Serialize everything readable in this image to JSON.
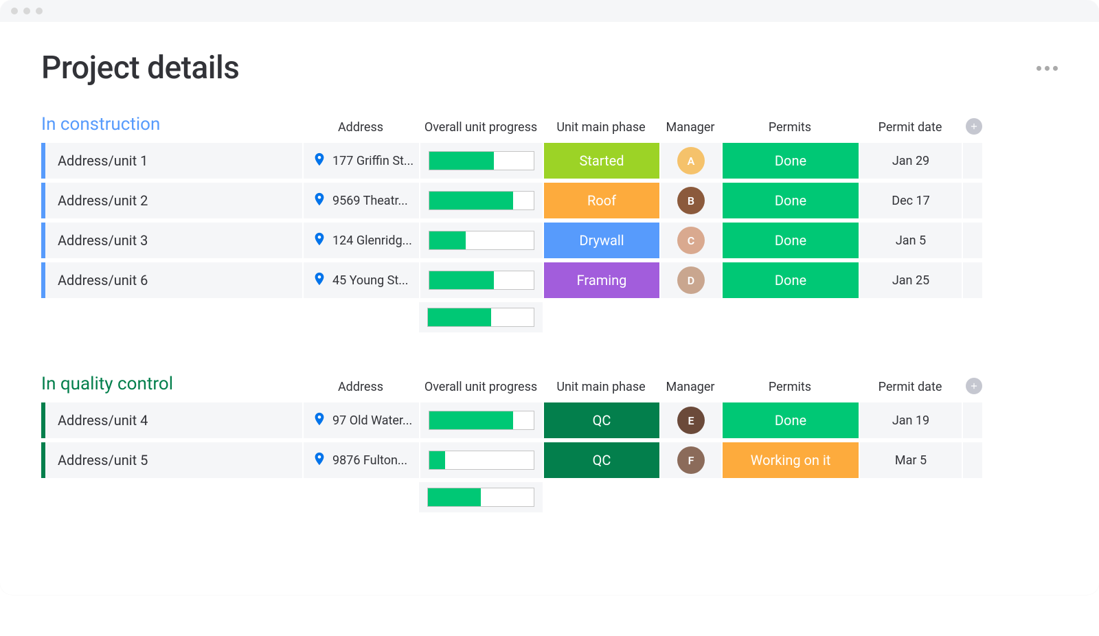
{
  "page_title": "Project details",
  "columns": {
    "address": "Address",
    "progress": "Overall unit progress",
    "phase": "Unit main phase",
    "manager": "Manager",
    "permits": "Permits",
    "permit_date": "Permit date"
  },
  "phase_colors": {
    "Started": "#9cd326",
    "Roof": "#fdab3d",
    "Drywall": "#579bfc",
    "Framing": "#a25ddc",
    "QC": "#037f4c"
  },
  "permit_colors": {
    "Done": "#00c875",
    "Working on it": "#fdab3d"
  },
  "avatar_colors": [
    "#f5c26b",
    "#8b5a3c",
    "#d9a98f",
    "#c9a68f",
    "#6b4a3a",
    "#8b6b5a"
  ],
  "groups": [
    {
      "title": "In construction",
      "color": "#579bfc",
      "summary_progress": 60,
      "rows": [
        {
          "name": "Address/unit 1",
          "address": "177 Griffin St...",
          "progress": 62,
          "phase": "Started",
          "manager_initial": "A",
          "permits": "Done",
          "permit_date": "Jan 29"
        },
        {
          "name": "Address/unit 2",
          "address": "9569 Theatr...",
          "progress": 80,
          "phase": "Roof",
          "manager_initial": "B",
          "permits": "Done",
          "permit_date": "Dec 17"
        },
        {
          "name": "Address/unit 3",
          "address": "124 Glenridg...",
          "progress": 35,
          "phase": "Drywall",
          "manager_initial": "C",
          "permits": "Done",
          "permit_date": "Jan 5"
        },
        {
          "name": "Address/unit 6",
          "address": "45 Young St...",
          "progress": 62,
          "phase": "Framing",
          "manager_initial": "D",
          "permits": "Done",
          "permit_date": "Jan 25"
        }
      ]
    },
    {
      "title": "In quality control",
      "color": "#037f4c",
      "summary_progress": 50,
      "rows": [
        {
          "name": "Address/unit 4",
          "address": "97 Old Water...",
          "progress": 80,
          "phase": "QC",
          "manager_initial": "E",
          "permits": "Done",
          "permit_date": "Jan 19"
        },
        {
          "name": "Address/unit 5",
          "address": "9876 Fulton...",
          "progress": 15,
          "phase": "QC",
          "manager_initial": "F",
          "permits": "Working on it",
          "permit_date": "Mar 5"
        }
      ]
    }
  ]
}
